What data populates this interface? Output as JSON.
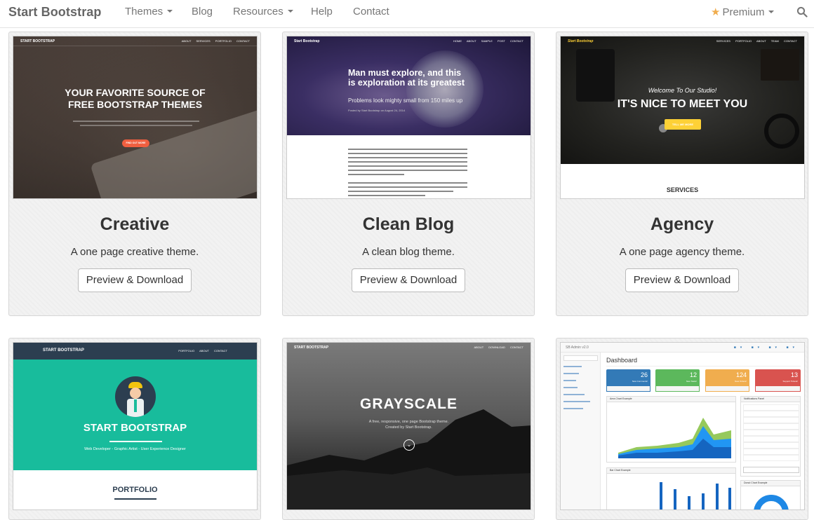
{
  "navbar": {
    "brand": "Start Bootstrap",
    "items": [
      {
        "label": "Themes",
        "dropdown": true
      },
      {
        "label": "Blog",
        "dropdown": false
      },
      {
        "label": "Resources",
        "dropdown": true
      },
      {
        "label": "Help",
        "dropdown": false
      },
      {
        "label": "Contact",
        "dropdown": false
      }
    ],
    "premium": {
      "label": "Premium",
      "icon": "star-icon",
      "dropdown": true
    },
    "search_icon": "search-icon"
  },
  "colors": {
    "accent_star": "#f0ad4e",
    "creative_button": "#f05f40",
    "agency_button": "#fed136",
    "freelancer_teal": "#18bc9c",
    "freelancer_nav": "#2c3e50"
  },
  "cards": [
    {
      "title": "Creative",
      "description": "A one page creative theme.",
      "button": "Preview & Download",
      "thumb": {
        "brand": "START BOOTSTRAP",
        "links": "ABOUT SERVICES PORTFOLIO CONTACT",
        "headline_1": "YOUR FAVORITE SOURCE OF",
        "headline_2": "FREE BOOTSTRAP THEMES",
        "cta": "FIND OUT MORE"
      }
    },
    {
      "title": "Clean Blog",
      "description": "A clean blog theme.",
      "button": "Preview & Download",
      "thumb": {
        "brand": "Start Bootstrap",
        "links": "HOME ABOUT SAMPLE POST CONTACT",
        "headline": "Man must explore, and this is exploration at its greatest",
        "subheadline": "Problems look mighty small from 150 miles up",
        "meta": "Posted by Start Bootstrap on August 24, 2014"
      }
    },
    {
      "title": "Agency",
      "description": "A one page agency theme.",
      "button": "Preview & Download",
      "thumb": {
        "brand": "Start Bootstrap",
        "links": "SERVICES PORTFOLIO ABOUT TEAM CONTACT",
        "welcome": "Welcome To Our Studio!",
        "headline": "IT'S NICE TO MEET YOU",
        "cta": "TELL ME MORE",
        "section": "SERVICES"
      }
    },
    {
      "title": "",
      "thumb": {
        "brand": "START BOOTSTRAP",
        "links": "PORTFOLIO ABOUT CONTACT",
        "headline": "START BOOTSTRAP",
        "tagline": "Web Developer - Graphic Artist - User Experience Designer",
        "section": "PORTFOLIO"
      }
    },
    {
      "title": "",
      "thumb": {
        "brand": "START BOOTSTRAP",
        "links": "ABOUT DOWNLOAD CONTACT",
        "headline": "GRAYSCALE",
        "tagline_1": "A free, responsive, one page Bootstrap theme.",
        "tagline_2": "Created by Start Bootstrap."
      }
    },
    {
      "title": "",
      "thumb": {
        "brand": "SB Admin v2.0",
        "page_title": "Dashboard",
        "panels": [
          {
            "value": "26",
            "label": "New Comments!",
            "color": "#337ab7"
          },
          {
            "value": "12",
            "label": "New Tasks!",
            "color": "#5cb85c"
          },
          {
            "value": "124",
            "label": "New Orders!",
            "color": "#f0ad4e"
          },
          {
            "value": "13",
            "label": "Support Tickets!",
            "color": "#d9534f"
          }
        ],
        "area_chart_title": "Area Chart Example",
        "bar_chart_title": "Bar Chart Example",
        "notifications_title": "Notifications Panel",
        "donut_title": "Donut Chart Example"
      }
    }
  ]
}
